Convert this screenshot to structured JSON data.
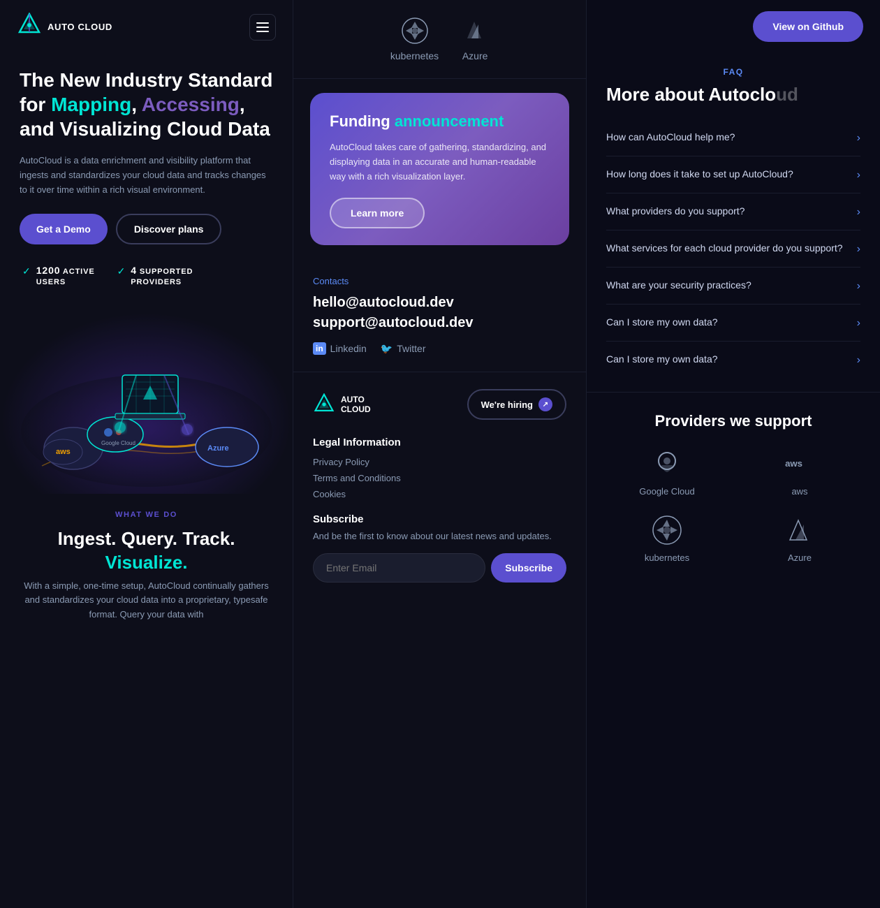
{
  "brand": {
    "name": "AUTO\nCLOUD",
    "logo_alt": "AutoCloud Logo"
  },
  "nav": {
    "hamburger_label": "Menu"
  },
  "hero": {
    "title_part1": "The New Industry Standard for ",
    "title_accent1": "Mapping",
    "title_part2": ", ",
    "title_accent2": "Accessing",
    "title_part3": ", and Visualizing Cloud Data",
    "description": "AutoCloud is a data enrichment and visibility platform that ingests and standardizes your cloud data and tracks changes to it over time within a rich visual environment.",
    "btn_demo": "Get a Demo",
    "btn_plans": "Discover plans"
  },
  "stats": {
    "users_num": "1200",
    "users_label": "ACTIVE\nUSERS",
    "providers_num": "4",
    "providers_label": "SUPPORTED\nPROVIDERS"
  },
  "what_we_do": {
    "section_label": "WHAT WE DO",
    "title_part1": "Ingest. Query. Track.",
    "title_accent": "Visualize.",
    "description": "With a simple, one-time setup, AutoCloud continually gathers and standardizes your cloud data into a proprietary, typesafe format. Query your data with"
  },
  "middle": {
    "providers_top": [
      {
        "name": "kubernetes",
        "icon": "kubernetes-icon"
      },
      {
        "name": "Azure",
        "icon": "azure-icon"
      }
    ],
    "funding_card": {
      "title_part1": "Funding ",
      "title_accent": "announcement",
      "description": "AutoCloud takes care of gathering, standardizing, and displaying data in an accurate and human-readable way with a rich visualization layer.",
      "btn_learn_more": "Learn more"
    },
    "contacts": {
      "label": "Contacts",
      "email1": "hello@autocloud.dev",
      "email2": "support@autocloud.dev",
      "social": [
        {
          "name": "Linkedin",
          "icon": "linkedin-icon"
        },
        {
          "name": "Twitter",
          "icon": "twitter-icon"
        }
      ]
    },
    "footer": {
      "hiring_btn": "We're hiring",
      "legal_title": "Legal Information",
      "legal_links": [
        {
          "label": "Privacy Policy"
        },
        {
          "label": "Terms and Conditions"
        },
        {
          "label": "Cookies"
        }
      ],
      "subscribe_title": "Subscribe",
      "subscribe_desc": "And be the first to know about our latest news and updates.",
      "email_placeholder": "Enter Email",
      "subscribe_btn": "Subscribe"
    }
  },
  "right": {
    "github_btn": "View on Github",
    "faq_label": "FAQ",
    "faq_title": "More about Autoclo",
    "faq_items": [
      {
        "question": "How can AutoCloud help me?"
      },
      {
        "question": "How long does it take to set up AutoCloud?"
      },
      {
        "question": "What providers do you support?"
      },
      {
        "question": "What services for each cloud provider do you support?"
      },
      {
        "question": "What are your security practices?"
      },
      {
        "question": "Can I store my own data?"
      },
      {
        "question": "Can I store my own data?"
      }
    ],
    "providers_section": {
      "title": "Providers we support",
      "items": [
        {
          "name": "Google Cloud",
          "icon": "google-cloud-icon"
        },
        {
          "name": "aws",
          "icon": "aws-icon"
        },
        {
          "name": "kubernetes",
          "icon": "kubernetes-icon"
        },
        {
          "name": "Azure",
          "icon": "azure-icon"
        }
      ]
    }
  }
}
